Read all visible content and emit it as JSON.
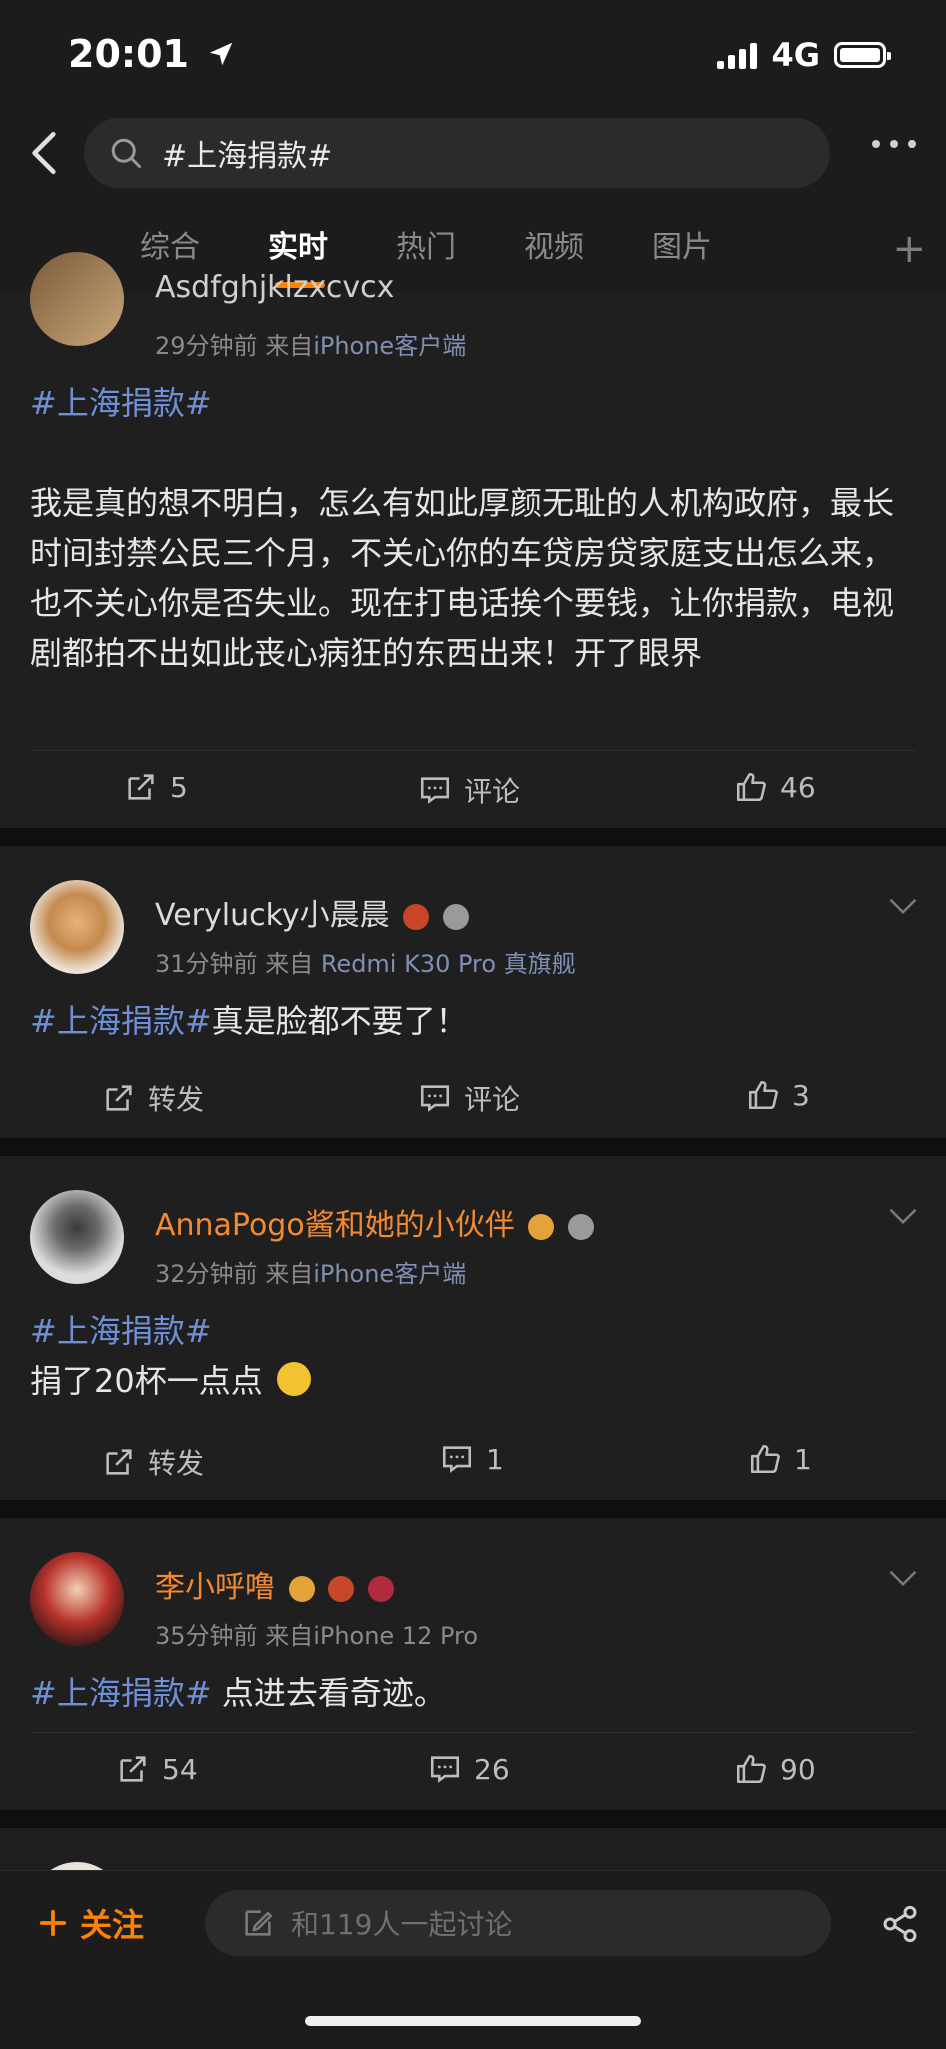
{
  "status": {
    "time": "20:01",
    "network": "4G"
  },
  "search": {
    "query": "#上海捐款#"
  },
  "tabs": [
    "综合",
    "实时",
    "热门",
    "视频",
    "图片"
  ],
  "posts": [
    {
      "username": "Asdfghjklzxcvcx",
      "time": "29分钟前",
      "from": "来自",
      "source": "iPhone客户端",
      "hashtag": "#上海捐款#",
      "text": "我是真的想不明白，怎么有如此厚颜无耻的人机构政府，最长时间封禁公民三个月，不关心你的车贷房贷家庭支出怎么来，也不关心你是否失业。现在打电话挨个要钱，让你捐款，电视剧都拍不出如此丧心病狂的东西出来！开了眼界",
      "repost": "5",
      "comment": "评论",
      "like": "46"
    },
    {
      "username": "Verylucky小晨晨",
      "time": "31分钟前",
      "from": "来自",
      "source": "Redmi K30 Pro 真旗舰",
      "hashtag": "#上海捐款#",
      "text": "真是脸都不要了！",
      "repost": "转发",
      "comment": "评论",
      "like": "3"
    },
    {
      "username": "AnnaPogo酱和她的小伙伴",
      "time": "32分钟前",
      "from": "来自",
      "source": "iPhone客户端",
      "hashtag": "#上海捐款#",
      "text": "捐了20杯一点点",
      "repost": "转发",
      "comment": "1",
      "like": "1"
    },
    {
      "username": "李小呼噜",
      "time": "35分钟前",
      "from": "来自",
      "source": "iPhone 12 Pro",
      "hashtag": "#上海捐款#",
      "text": " 点进去看奇迹。",
      "repost": "54",
      "comment": "26",
      "like": "90"
    }
  ],
  "bottom": {
    "follow": "关注",
    "placeholder": "和119人一起讨论"
  },
  "colors": {
    "accent": "#ff8200",
    "link": "#6f8fd6",
    "username_vip": "#f28a32"
  }
}
